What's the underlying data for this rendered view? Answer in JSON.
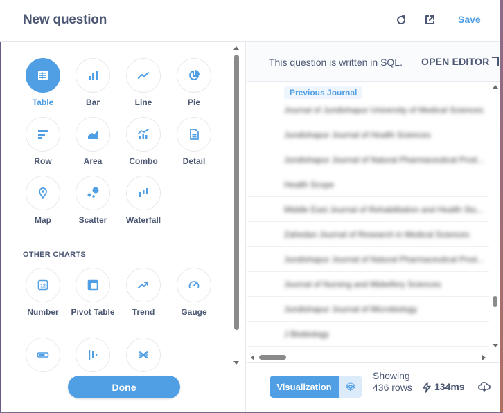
{
  "header": {
    "title": "New question",
    "save_label": "Save"
  },
  "sidebar": {
    "primary_charts": [
      {
        "label": "Table",
        "icon": "table-icon",
        "active": true
      },
      {
        "label": "Bar",
        "icon": "bar-icon"
      },
      {
        "label": "Line",
        "icon": "line-icon"
      },
      {
        "label": "Pie",
        "icon": "pie-icon"
      },
      {
        "label": "Row",
        "icon": "row-icon"
      },
      {
        "label": "Area",
        "icon": "area-icon"
      },
      {
        "label": "Combo",
        "icon": "combo-icon"
      },
      {
        "label": "Detail",
        "icon": "detail-icon"
      },
      {
        "label": "Map",
        "icon": "map-icon"
      },
      {
        "label": "Scatter",
        "icon": "scatter-icon"
      },
      {
        "label": "Waterfall",
        "icon": "waterfall-icon"
      }
    ],
    "other_charts_header": "OTHER CHARTS",
    "other_charts": [
      {
        "label": "Number",
        "icon": "number-icon"
      },
      {
        "label": "Pivot Table",
        "icon": "pivot-icon"
      },
      {
        "label": "Trend",
        "icon": "trend-icon"
      },
      {
        "label": "Gauge",
        "icon": "gauge-icon"
      },
      {
        "label": "",
        "icon": "progress-icon"
      },
      {
        "label": "",
        "icon": "funnel-icon"
      },
      {
        "label": "",
        "icon": "sankey-icon"
      }
    ],
    "done_label": "Done"
  },
  "main": {
    "sql_notice": "This question is written in SQL.",
    "open_editor_label": "OPEN EDITOR",
    "table": {
      "column_header": "Previous Journal",
      "rows": [
        "Journal of Jundishapur University of Medical Sciences",
        "Jundishapur Journal of Health Sciences",
        "Jundishapur Journal of Natural Pharmaceutical Prod...",
        "Health Scope",
        "Middle East Journal of Rehabilitation and Health Stu...",
        "Zahedan Journal of Research in Medical Sciences",
        "Jundishapur Journal of Natural Pharmaceutical Prod...",
        "Journal of Nursing and Midwifery Sciences",
        "Jundishapur Journal of Microbiology",
        "J Biobiology"
      ]
    },
    "footer": {
      "visualization_label": "Visualization",
      "showing_text": "Showing 436 rows",
      "timing": "134ms"
    }
  },
  "colors": {
    "brand": "#509ee3",
    "text": "#4c5773",
    "border": "#e5e9ee"
  }
}
